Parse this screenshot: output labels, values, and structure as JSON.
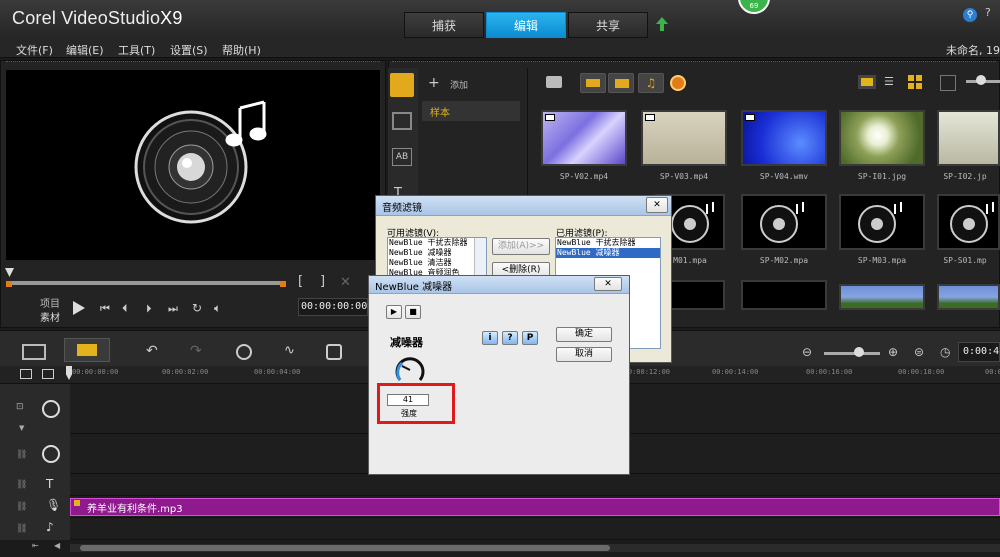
{
  "app": {
    "title": "Corel VideoStudio",
    "version": "X9",
    "badge": "69"
  },
  "tabs": [
    {
      "label": "捕获"
    },
    {
      "label": "编辑"
    },
    {
      "label": "共享"
    }
  ],
  "menu": [
    {
      "label": "文件(F)"
    },
    {
      "label": "编辑(E)"
    },
    {
      "label": "工具(T)"
    },
    {
      "label": "设置(S)"
    },
    {
      "label": "帮助(H)"
    }
  ],
  "project_name": "未命名, 19",
  "preview": {
    "project_label": "项目",
    "clip_label": "素材",
    "timecode": "00:00:00:00"
  },
  "library": {
    "add_label": "添加",
    "folder": "样本"
  },
  "thumbnails": [
    {
      "label": "SP-V02.mp4",
      "kind": "purple"
    },
    {
      "label": "SP-V03.mp4",
      "kind": "beige"
    },
    {
      "label": "SP-V04.wmv",
      "kind": "blue"
    },
    {
      "label": "SP-I01.jpg",
      "kind": "dandelion"
    },
    {
      "label": "SP-I02.jp",
      "kind": "field"
    },
    {
      "label": "M01.mpa",
      "kind": "music"
    },
    {
      "label": "SP-M02.mpa",
      "kind": "music"
    },
    {
      "label": "SP-M03.mpa",
      "kind": "music"
    },
    {
      "label": "SP-S01.mp",
      "kind": "music"
    }
  ],
  "audio_filter_dialog": {
    "title": "音频滤镜",
    "available_label": "可用滤镜(V):",
    "available": [
      "NewBlue 干扰去除器",
      "NewBlue 减噪器",
      "NewBlue 清洁器",
      "NewBlue 音频润色"
    ],
    "applied_label": "已用滤镜(P):",
    "applied": [
      "NewBlue 干扰去除器",
      "NewBlue 减噪器"
    ],
    "add_button": "添加(A)>>",
    "delete_button": "<删除(R)"
  },
  "noise_dialog": {
    "title": "NewBlue 减噪器",
    "plugin_name": "减噪器",
    "value": "41",
    "value_label": "强度",
    "ok": "确定",
    "cancel": "取消",
    "help_buttons": [
      "i",
      "?",
      "P"
    ],
    "close": "✕"
  },
  "timeline": {
    "timecode": "0:00:4",
    "ruler": [
      "00:00:00:00",
      "00:00:02:00",
      "00:00:04:00",
      "00:00:12:00",
      "00:00:14:00",
      "00:00:16:00",
      "00:00:18:00",
      "00:00:2"
    ],
    "audio_clip": "养羊业有利条件.mp3"
  },
  "colors": {
    "accent": "#19a5ea",
    "audio_clip": "#8e1a8e",
    "highlight_box": "#e0191b",
    "badge": "#3bb54a"
  }
}
